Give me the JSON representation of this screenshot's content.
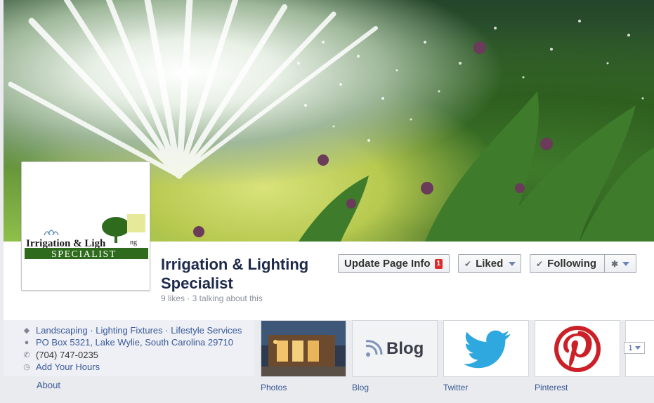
{
  "page": {
    "title": "Irrigation & Lighting Specialist",
    "stats": "9 likes · 3 talking about this"
  },
  "logo": {
    "line1": "Irrigation & Ligh",
    "line1_tail": "ng",
    "line2": "SPECIALIST"
  },
  "actions": {
    "update_label": "Update Page Info",
    "update_badge": "1",
    "liked_label": "Liked",
    "following_label": "Following"
  },
  "about": {
    "categories": "Landscaping · Lighting Fixtures · Lifestyle Services",
    "address": "PO Box 5321, Lake Wylie, South Carolina 29710",
    "phone": "(704) 747-0235",
    "hours": "Add Your Hours",
    "link": "About"
  },
  "apps": [
    {
      "label": "Photos"
    },
    {
      "label": "Blog",
      "title": "Blog"
    },
    {
      "label": "Twitter"
    },
    {
      "label": "Pinterest"
    }
  ],
  "more_count": "1",
  "colors": {
    "link": "#3b5998",
    "title": "#1e2a4a",
    "badge": "#e02a2a",
    "twitter": "#2fa8e0",
    "pinterest": "#cb2027",
    "logo_green": "#2f6b1d"
  }
}
